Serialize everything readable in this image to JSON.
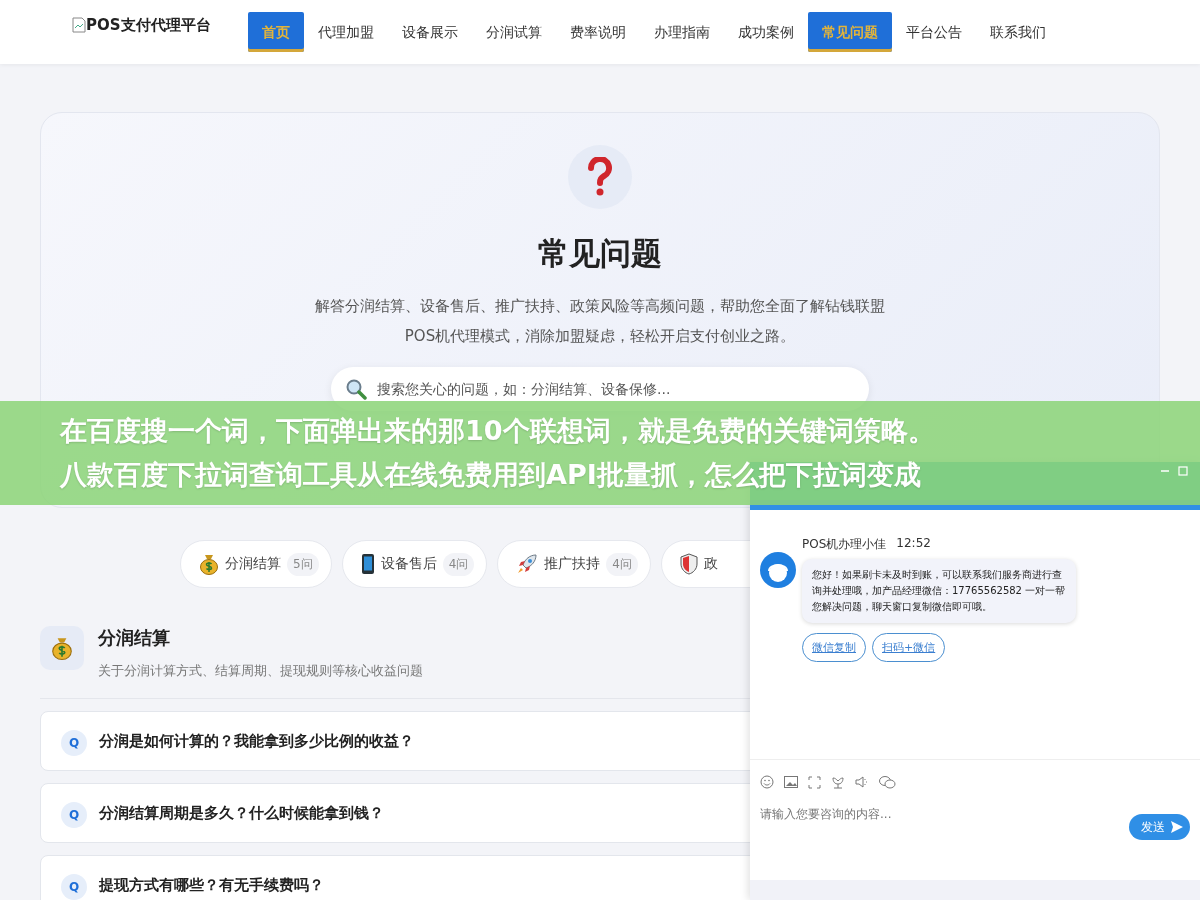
{
  "header": {
    "logo_text": "POS支付代理平台",
    "nav": [
      {
        "label": "首页",
        "selected": true
      },
      {
        "label": "代理加盟",
        "selected": false
      },
      {
        "label": "设备展示",
        "selected": false
      },
      {
        "label": "分润试算",
        "selected": false
      },
      {
        "label": "费率说明",
        "selected": false
      },
      {
        "label": "办理指南",
        "selected": false
      },
      {
        "label": "成功案例",
        "selected": false
      },
      {
        "label": "常见问题",
        "selected": true
      },
      {
        "label": "平台公告",
        "selected": false
      },
      {
        "label": "联系我们",
        "selected": false
      }
    ]
  },
  "hero": {
    "title": "常见问题",
    "description": "解答分润结算、设备售后、推广扶持、政策风险等高频问题，帮助您全面了解钻钱联盟POS机代理模式，消除加盟疑虑，轻松开启支付创业之路。",
    "search": {
      "placeholder": "搜索您关心的问题，如：分润结算、设备保修..."
    }
  },
  "categories": [
    {
      "label": "分润结算",
      "count": "5问"
    },
    {
      "label": "设备售后",
      "count": "4问"
    },
    {
      "label": "推广扶持",
      "count": "4问"
    },
    {
      "label": "政"
    }
  ],
  "section": {
    "title": "分润结算",
    "subtitle": "关于分润计算方式、结算周期、提现规则等核心收益问题",
    "questions": [
      {
        "badge": "Q",
        "text": "分润是如何计算的？我能拿到多少比例的收益？"
      },
      {
        "badge": "Q",
        "text": "分润结算周期是多久？什么时候能拿到钱？"
      },
      {
        "badge": "Q",
        "text": "提现方式有哪些？有无手续费吗？"
      }
    ]
  },
  "banner": {
    "lines": [
      "在百度搜一个词，下面弹出来的那10个联想词，就是免费的关键词策略。",
      "八款百度下拉词查询工具从在线免费用到API批量抓，怎么把下拉词变成"
    ]
  },
  "chat": {
    "agent_name": "POS机办理小佳",
    "time": "12:52",
    "message": "您好！如果刷卡未及时到账，可以联系我们服务商进行查询并处理哦，加产品经理微信：17765562582 一对一帮您解决问题，聊天窗口复制微信即可哦。",
    "actions": [
      "微信复制",
      "扫码+微信"
    ],
    "input": {
      "placeholder": "请输入您要咨询的内容..."
    },
    "send_label": "发送"
  }
}
